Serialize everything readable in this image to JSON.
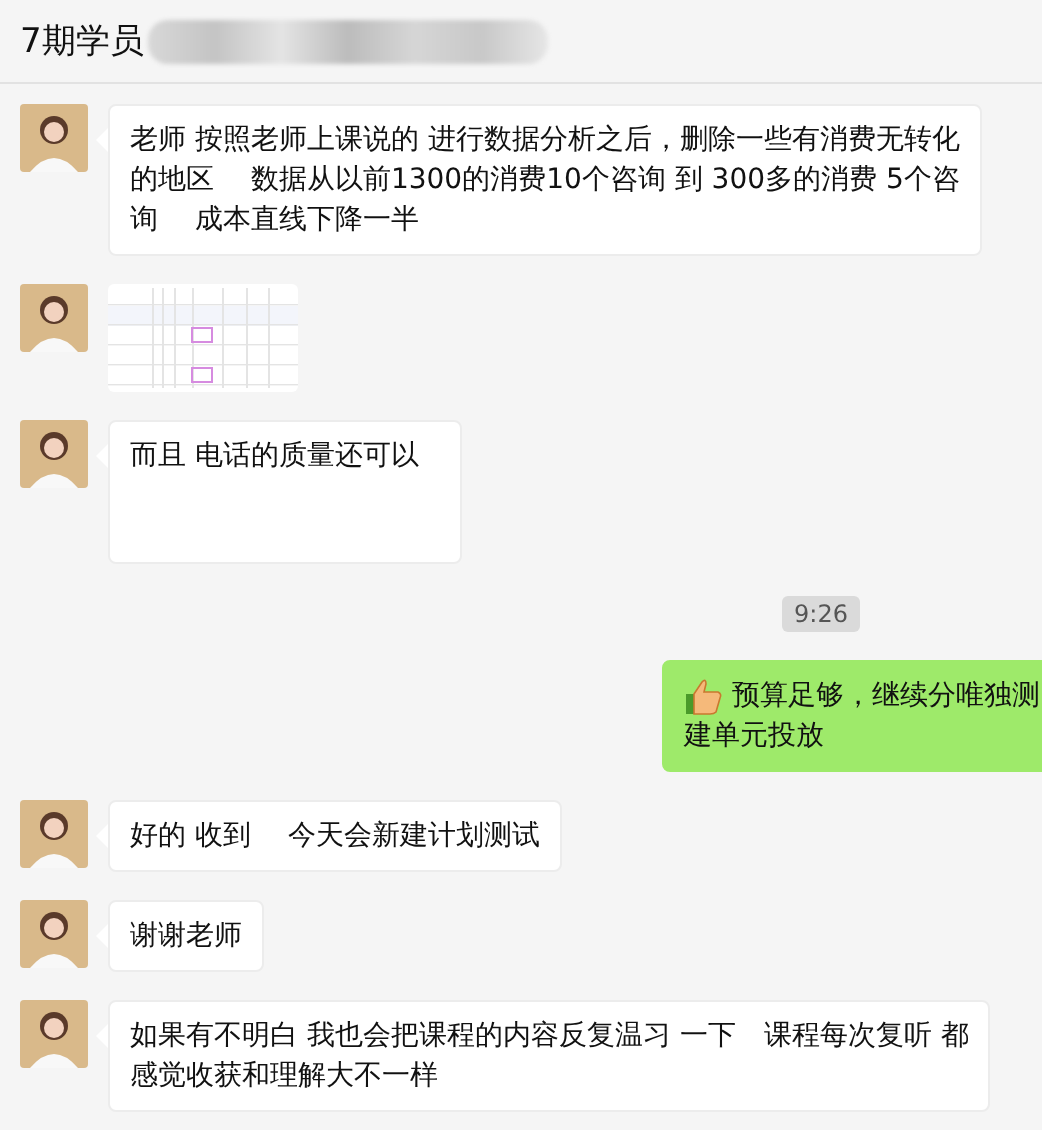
{
  "window": {
    "title": "7期学员"
  },
  "messages": [
    {
      "kind": "incoming",
      "thumbs_up": false,
      "lines": [
        "老师 按照老师上课说的 进行数据分析之后，删除一些有消费无转化",
        "的地区　 数据从以前1300的消费10个咨询  到 300多的消费 5个咨",
        "询　 成本直线下降一半"
      ]
    },
    {
      "kind": "incoming_image"
    },
    {
      "kind": "incoming",
      "thumbs_up": false,
      "tall": true,
      "lines": [
        "而且 电话的质量还可以"
      ]
    },
    {
      "kind": "time",
      "text": "9:26"
    },
    {
      "kind": "outgoing",
      "thumbs_up": true,
      "lines": [
        "预算足够，继续分唯独测",
        "建单元投放"
      ]
    },
    {
      "kind": "incoming",
      "thumbs_up": false,
      "lines": [
        "好的 收到　 今天会新建计划测试"
      ]
    },
    {
      "kind": "incoming",
      "thumbs_up": false,
      "lines": [
        "谢谢老师"
      ]
    },
    {
      "kind": "incoming",
      "thumbs_up": false,
      "lines": [
        "如果有不明白 我也会把课程的内容反复温习 一下　课程每次复听 都",
        "感觉收获和理解大不一样"
      ]
    }
  ]
}
